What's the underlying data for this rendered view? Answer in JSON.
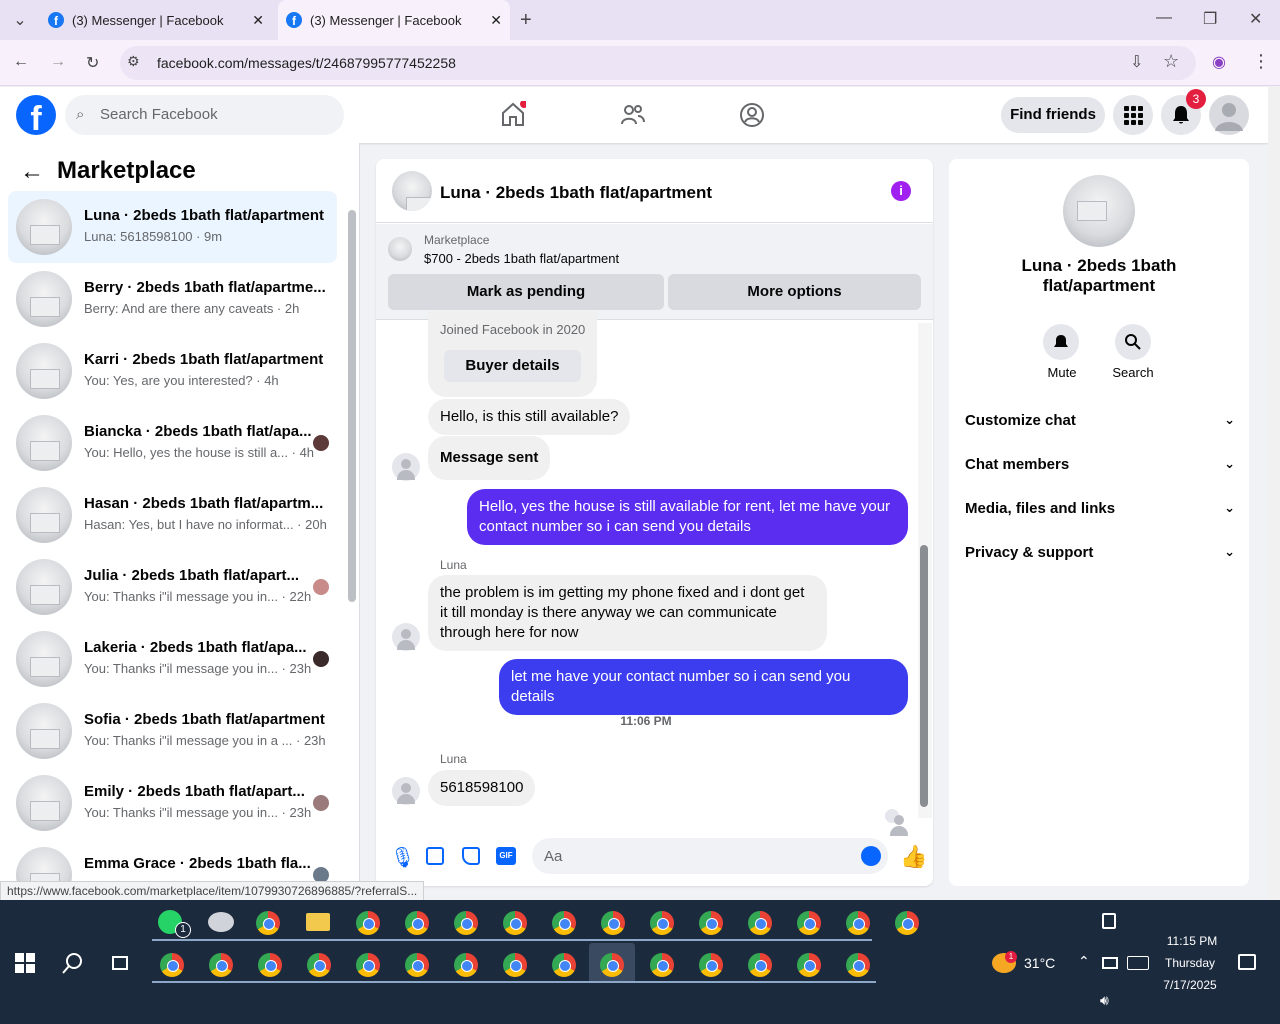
{
  "browser": {
    "tabs": [
      {
        "title": "(3) Messenger | Facebook"
      },
      {
        "title": "(3) Messenger | Facebook"
      }
    ],
    "url": "facebook.com/messages/t/24687995777452258",
    "status_url": "https://www.facebook.com/marketplace/item/1079930726896885/?referralS..."
  },
  "header": {
    "search_placeholder": "Search Facebook",
    "find_friends": "Find friends",
    "notif_count": "3"
  },
  "left": {
    "title": "Marketplace",
    "conversations": [
      {
        "name": "Luna · 2beds 1bath flat/apartment",
        "sub": "Luna: 5618598100 · 9m"
      },
      {
        "name": "Berry · 2beds 1bath flat/apartme...",
        "sub": "Berry: And are there any caveats · 2h"
      },
      {
        "name": "Karri · 2beds 1bath flat/apartment",
        "sub": "You: Yes, are you interested? · 4h"
      },
      {
        "name": "Biancka · 2beds 1bath flat/apa...",
        "sub": "You: Hello, yes the house is still a... · 4h"
      },
      {
        "name": "Hasan · 2beds 1bath flat/apartm...",
        "sub": "Hasan: Yes, but I have no informat... · 20h"
      },
      {
        "name": "Julia · 2beds 1bath flat/apart...",
        "sub": "You: Thanks i\"il message you in... · 22h"
      },
      {
        "name": "Lakeria · 2beds 1bath flat/apa...",
        "sub": "You: Thanks i\"il message you in... · 23h"
      },
      {
        "name": "Sofia · 2beds 1bath flat/apartment",
        "sub": "You: Thanks i\"il message you in a ... · 23h"
      },
      {
        "name": "Emily · 2beds 1bath flat/apart...",
        "sub": "You: Thanks i\"il message you in... · 23h"
      },
      {
        "name": "Emma Grace · 2beds 1bath fla...",
        "sub": ""
      }
    ]
  },
  "chat": {
    "title": "Luna · 2beds 1bath flat/apartment",
    "listing_label": "Marketplace",
    "listing_title": "$700 - 2beds 1bath flat/apartment",
    "mark_pending": "Mark as pending",
    "more_options": "More options",
    "joined": "Joined Facebook in 2020",
    "buyer_details": "Buyer details",
    "msg1": "Hello, is this still available?",
    "msg2": "Message sent",
    "msg3": "Hello, yes the house is still available for rent, let me have your contact number so i can send you details",
    "sender": "Luna",
    "msg4": "the problem is im getting my phone fixed and i dont get it till monday is there anyway we can communicate through here for now",
    "msg5": "let me have your contact number so i can send you details",
    "time": "11:06 PM",
    "msg6": "5618598100",
    "composer_placeholder": "Aa"
  },
  "right": {
    "title": "Luna · 2beds 1bath flat/apartment",
    "mute": "Mute",
    "search": "Search",
    "menu": [
      "Customize chat",
      "Chat members",
      "Media, files and links",
      "Privacy & support"
    ]
  },
  "taskbar": {
    "temp": "31°C",
    "time": "11:15 PM",
    "day": "Thursday",
    "date": "7/17/2025",
    "whatsapp_badge": "1",
    "weather_badge": "1"
  },
  "colors": {
    "accent": "#5b2df0",
    "fb_blue": "#0866ff",
    "notif_red": "#e41e3f"
  }
}
